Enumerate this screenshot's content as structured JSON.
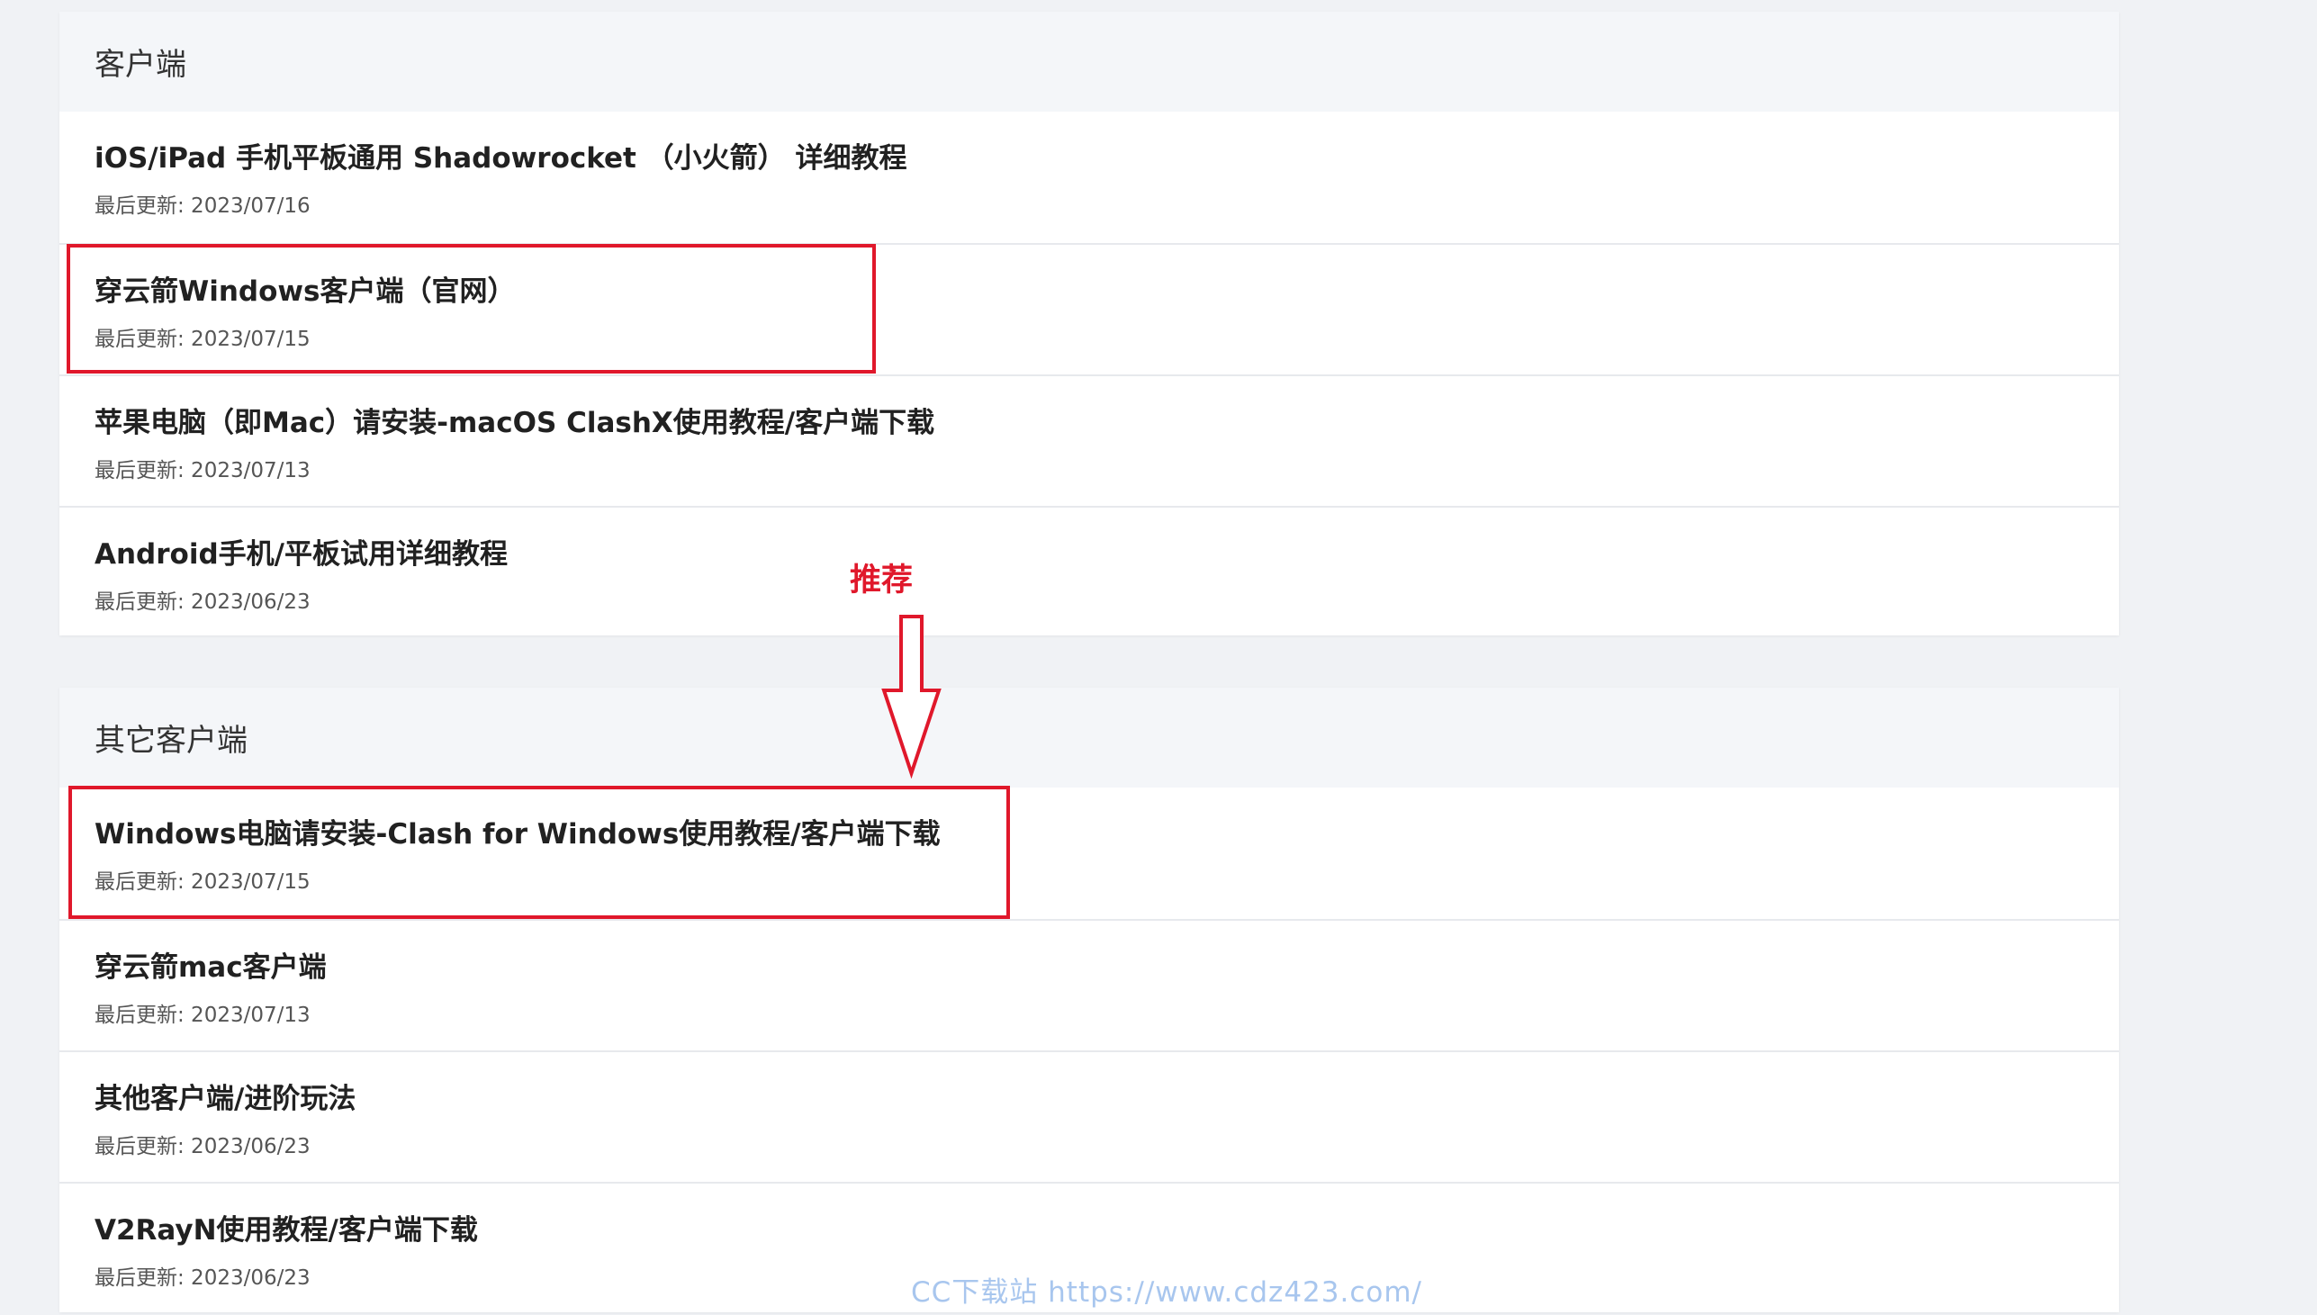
{
  "section_clients": {
    "title": "客户端",
    "items": [
      {
        "title": "iOS/iPad 手机平板通用 Shadowrocket （小火箭） 详细教程",
        "updated": "最后更新: 2023/07/16"
      },
      {
        "title": "穿云箭Windows客户端（官网）",
        "updated": "最后更新: 2023/07/15"
      },
      {
        "title": "苹果电脑（即Mac）请安装-macOS ClashX使用教程/客户端下载",
        "updated": "最后更新: 2023/07/13"
      },
      {
        "title": "Android手机/平板试用详细教程",
        "updated": "最后更新: 2023/06/23"
      }
    ]
  },
  "section_other": {
    "title": "其它客户端",
    "items": [
      {
        "title": "Windows电脑请安装-Clash for Windows使用教程/客户端下载",
        "updated": "最后更新: 2023/07/15"
      },
      {
        "title": "穿云箭mac客户端",
        "updated": "最后更新: 2023/07/13"
      },
      {
        "title": "其他客户端/进阶玩法",
        "updated": "最后更新: 2023/06/23"
      },
      {
        "title": "V2RayN使用教程/客户端下载",
        "updated": "最后更新: 2023/06/23"
      }
    ]
  },
  "annotation": {
    "label": "推荐",
    "color": "#e0182b"
  },
  "watermark": "CC下载站  https://www.cdz423.com/"
}
